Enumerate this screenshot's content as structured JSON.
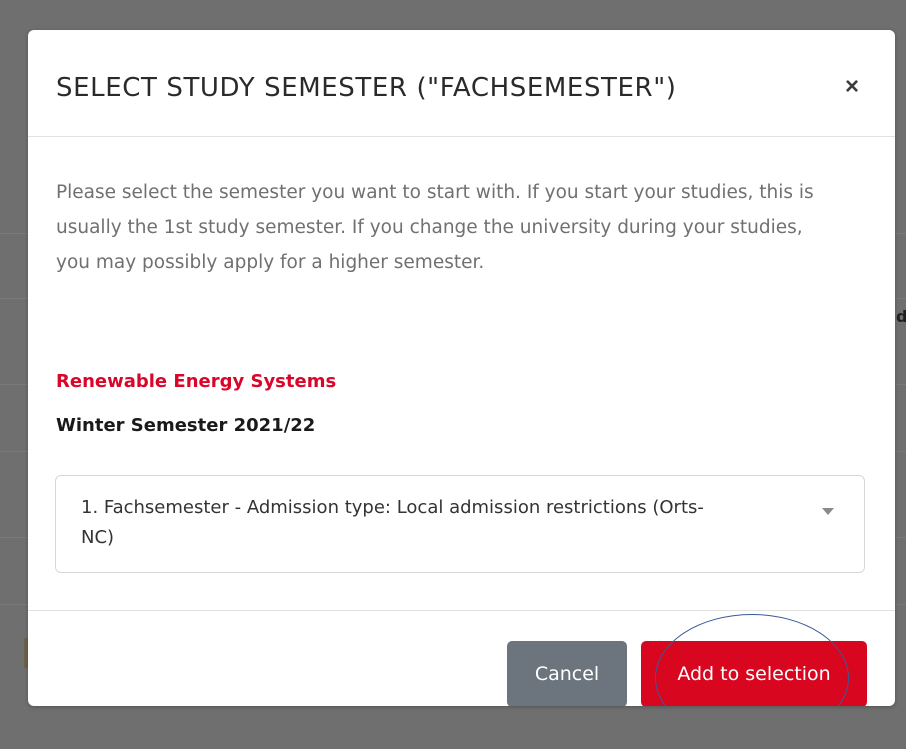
{
  "modal": {
    "title": "SELECT STUDY SEMESTER (\"FACHSEMESTER\")",
    "close_symbol": "×",
    "description": "Please select the semester you want to start with. If you start your studies, this is usually the 1st study semester. If you change the university during your studies, you may possibly apply for a higher semester.",
    "program": "Renewable Energy Systems",
    "semester": "Winter Semester 2021/22",
    "select": {
      "selected_value": "1. Fachsemester - Admission type: Local admission restrictions (Orts-NC)"
    },
    "footer": {
      "cancel_label": "Cancel",
      "add_label": "Add to selection"
    }
  },
  "background": {
    "visible_fragment": "d"
  },
  "colors": {
    "overlay": "#6f6f6f",
    "accent_red": "#d9061f",
    "program_red": "#d9062a",
    "cancel_gray": "#6c757d",
    "annotation_blue": "#3a5a96"
  },
  "icons": {
    "close": "close-icon",
    "dropdown": "chevron-down-icon"
  }
}
